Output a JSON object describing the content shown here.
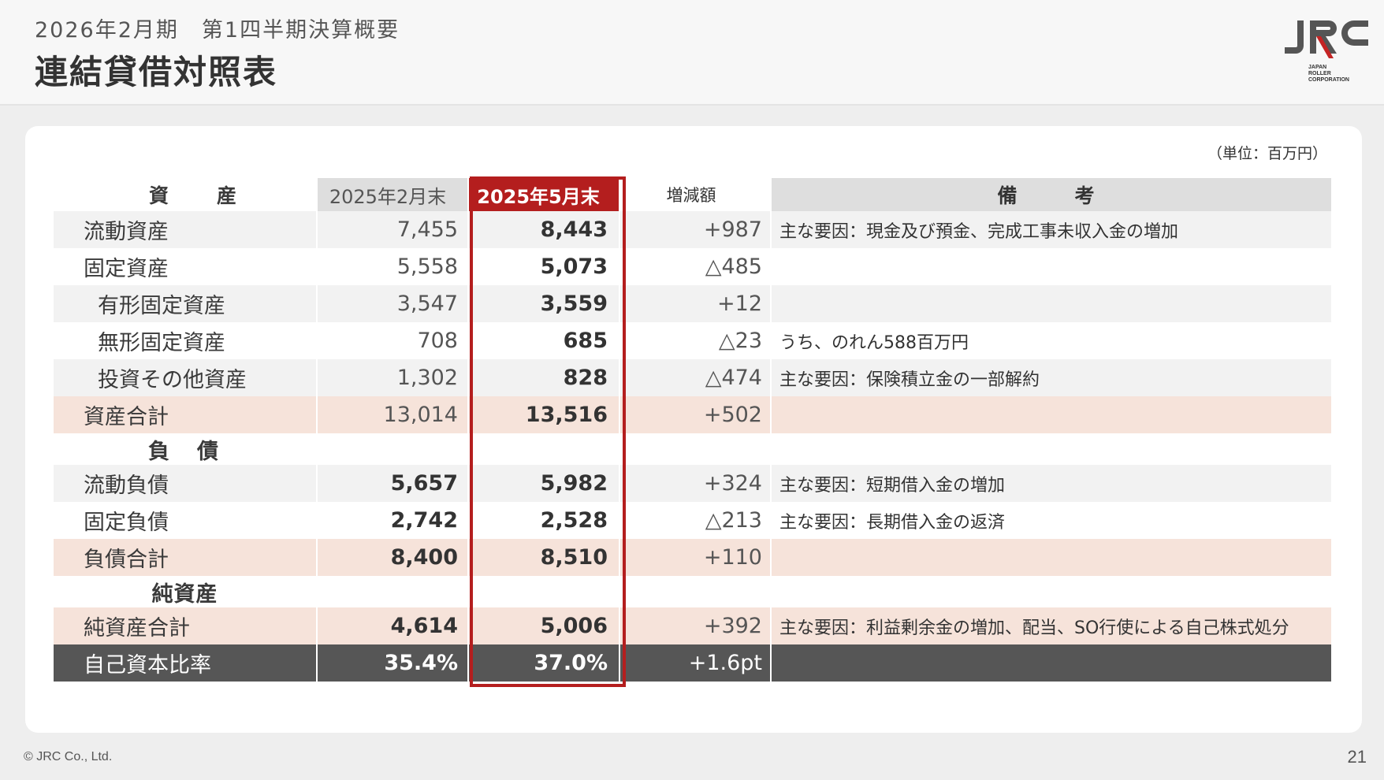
{
  "header": {
    "subtitle": "2026年2月期　第1四半期決算概要",
    "title": "連結貸借対照表"
  },
  "logo": {
    "mark": "JRC",
    "line1": "JAPAN",
    "line2": "ROLLER",
    "line3": "CORPORATION"
  },
  "unit": "（単位：百万円）",
  "table": {
    "headers": {
      "label": "資　産",
      "prev": "2025年2月末",
      "cur": "2025年5月末",
      "diff": "増減額",
      "note": "備　考"
    },
    "assets": [
      {
        "label": "流動資産",
        "prev": "7,455",
        "cur": "8,443",
        "diff": "+987",
        "note": "主な要因：現金及び預金、完成工事未収入金の増加"
      },
      {
        "label": "固定資産",
        "prev": "5,558",
        "cur": "5,073",
        "diff": "△485",
        "note": ""
      },
      {
        "label": "有形固定資産",
        "prev": "3,547",
        "cur": "3,559",
        "diff": "+12",
        "note": ""
      },
      {
        "label": "無形固定資産",
        "prev": "708",
        "cur": "685",
        "diff": "△23",
        "note": "うち、のれん588百万円"
      },
      {
        "label": "投資その他資産",
        "prev": "1,302",
        "cur": "828",
        "diff": "△474",
        "note": "主な要因：保険積立金の一部解約"
      },
      {
        "label": "資産合計",
        "prev": "13,014",
        "cur": "13,516",
        "diff": "+502",
        "note": ""
      }
    ],
    "liabilities_heading": "負　債",
    "liabilities": [
      {
        "label": "流動負債",
        "prev": "5,657",
        "cur": "5,982",
        "diff": "+324",
        "note": "主な要因：短期借入金の増加"
      },
      {
        "label": "固定負債",
        "prev": "2,742",
        "cur": "2,528",
        "diff": "△213",
        "note": "主な要因：長期借入金の返済"
      },
      {
        "label": "負債合計",
        "prev": "8,400",
        "cur": "8,510",
        "diff": "+110",
        "note": ""
      }
    ],
    "net_assets_heading": "純資産",
    "net_assets": [
      {
        "label": "純資産合計",
        "prev": "4,614",
        "cur": "5,006",
        "diff": "+392",
        "note": "主な要因：利益剰余金の増加、配当、SO行使による自己株式処分"
      }
    ],
    "equity_ratio": {
      "label": "自己資本比率",
      "prev": "35.4%",
      "cur": "37.0%",
      "diff": "+1.6pt",
      "note": ""
    }
  },
  "footer": {
    "copyright": "© JRC Co., Ltd.",
    "page": "21"
  },
  "colors": {
    "accent": "#b41e1e",
    "total_row": "#f6e3da",
    "alt_row": "#f2f2f2",
    "dark_row": "#565656"
  }
}
